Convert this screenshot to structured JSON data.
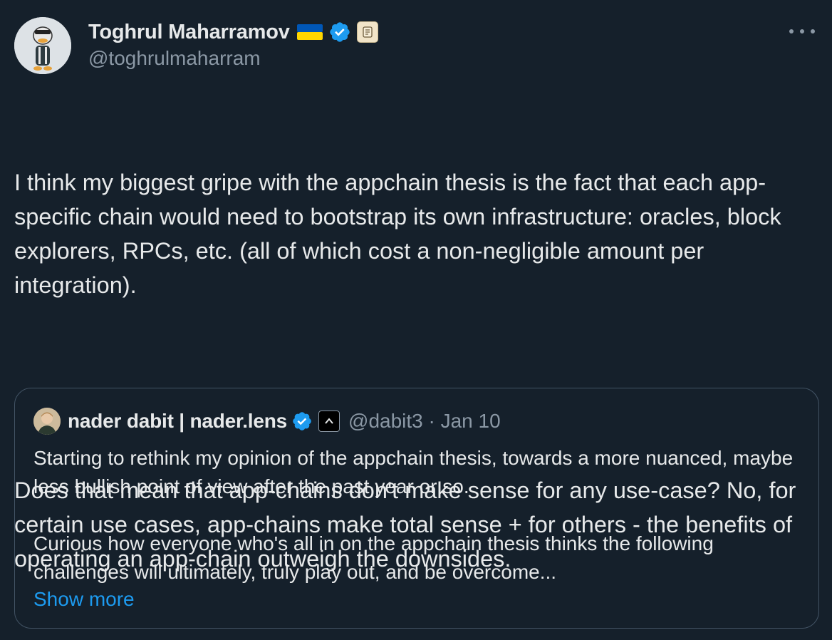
{
  "author": {
    "display_name": "Toghrul Maharramov",
    "handle": "@toghrulmaharram",
    "flag_icon": "ukraine-flag-icon",
    "verified_icon": "verified-badge-icon",
    "affiliation_icon": "scroll-icon"
  },
  "menu": {
    "more_icon": "more-options-icon"
  },
  "tweet": {
    "paragraph_1": "I think my biggest gripe with the appchain thesis is the fact that each app-specific chain would need to bootstrap its own infrastructure: oracles, block explorers, RPCs, etc. (all of which cost a non-negligible amount per integration).",
    "paragraph_2": "Does that mean that app-chains don't make sense for any use-case? No, for certain use cases, app-chains make total sense + for others - the benefits of operating an app-chain outweigh the downsides."
  },
  "quote": {
    "display_name": "nader dabit | nader.lens",
    "handle_date": "@dabit3 · Jan 10",
    "paragraph_1": "Starting to rethink my opinion of the appchain thesis, towards a more nuanced, maybe less bullish point of view after the past year or so.",
    "paragraph_2": "Curious how everyone who's all in on the appchain thesis thinks the following challenges will ultimately, truly play out, and be overcome...",
    "show_more": "Show more"
  },
  "colors": {
    "background": "#15202b",
    "text": "#e7e9ea",
    "secondary_text": "#8b98a5",
    "link": "#1d9bf0",
    "border": "#425364"
  }
}
